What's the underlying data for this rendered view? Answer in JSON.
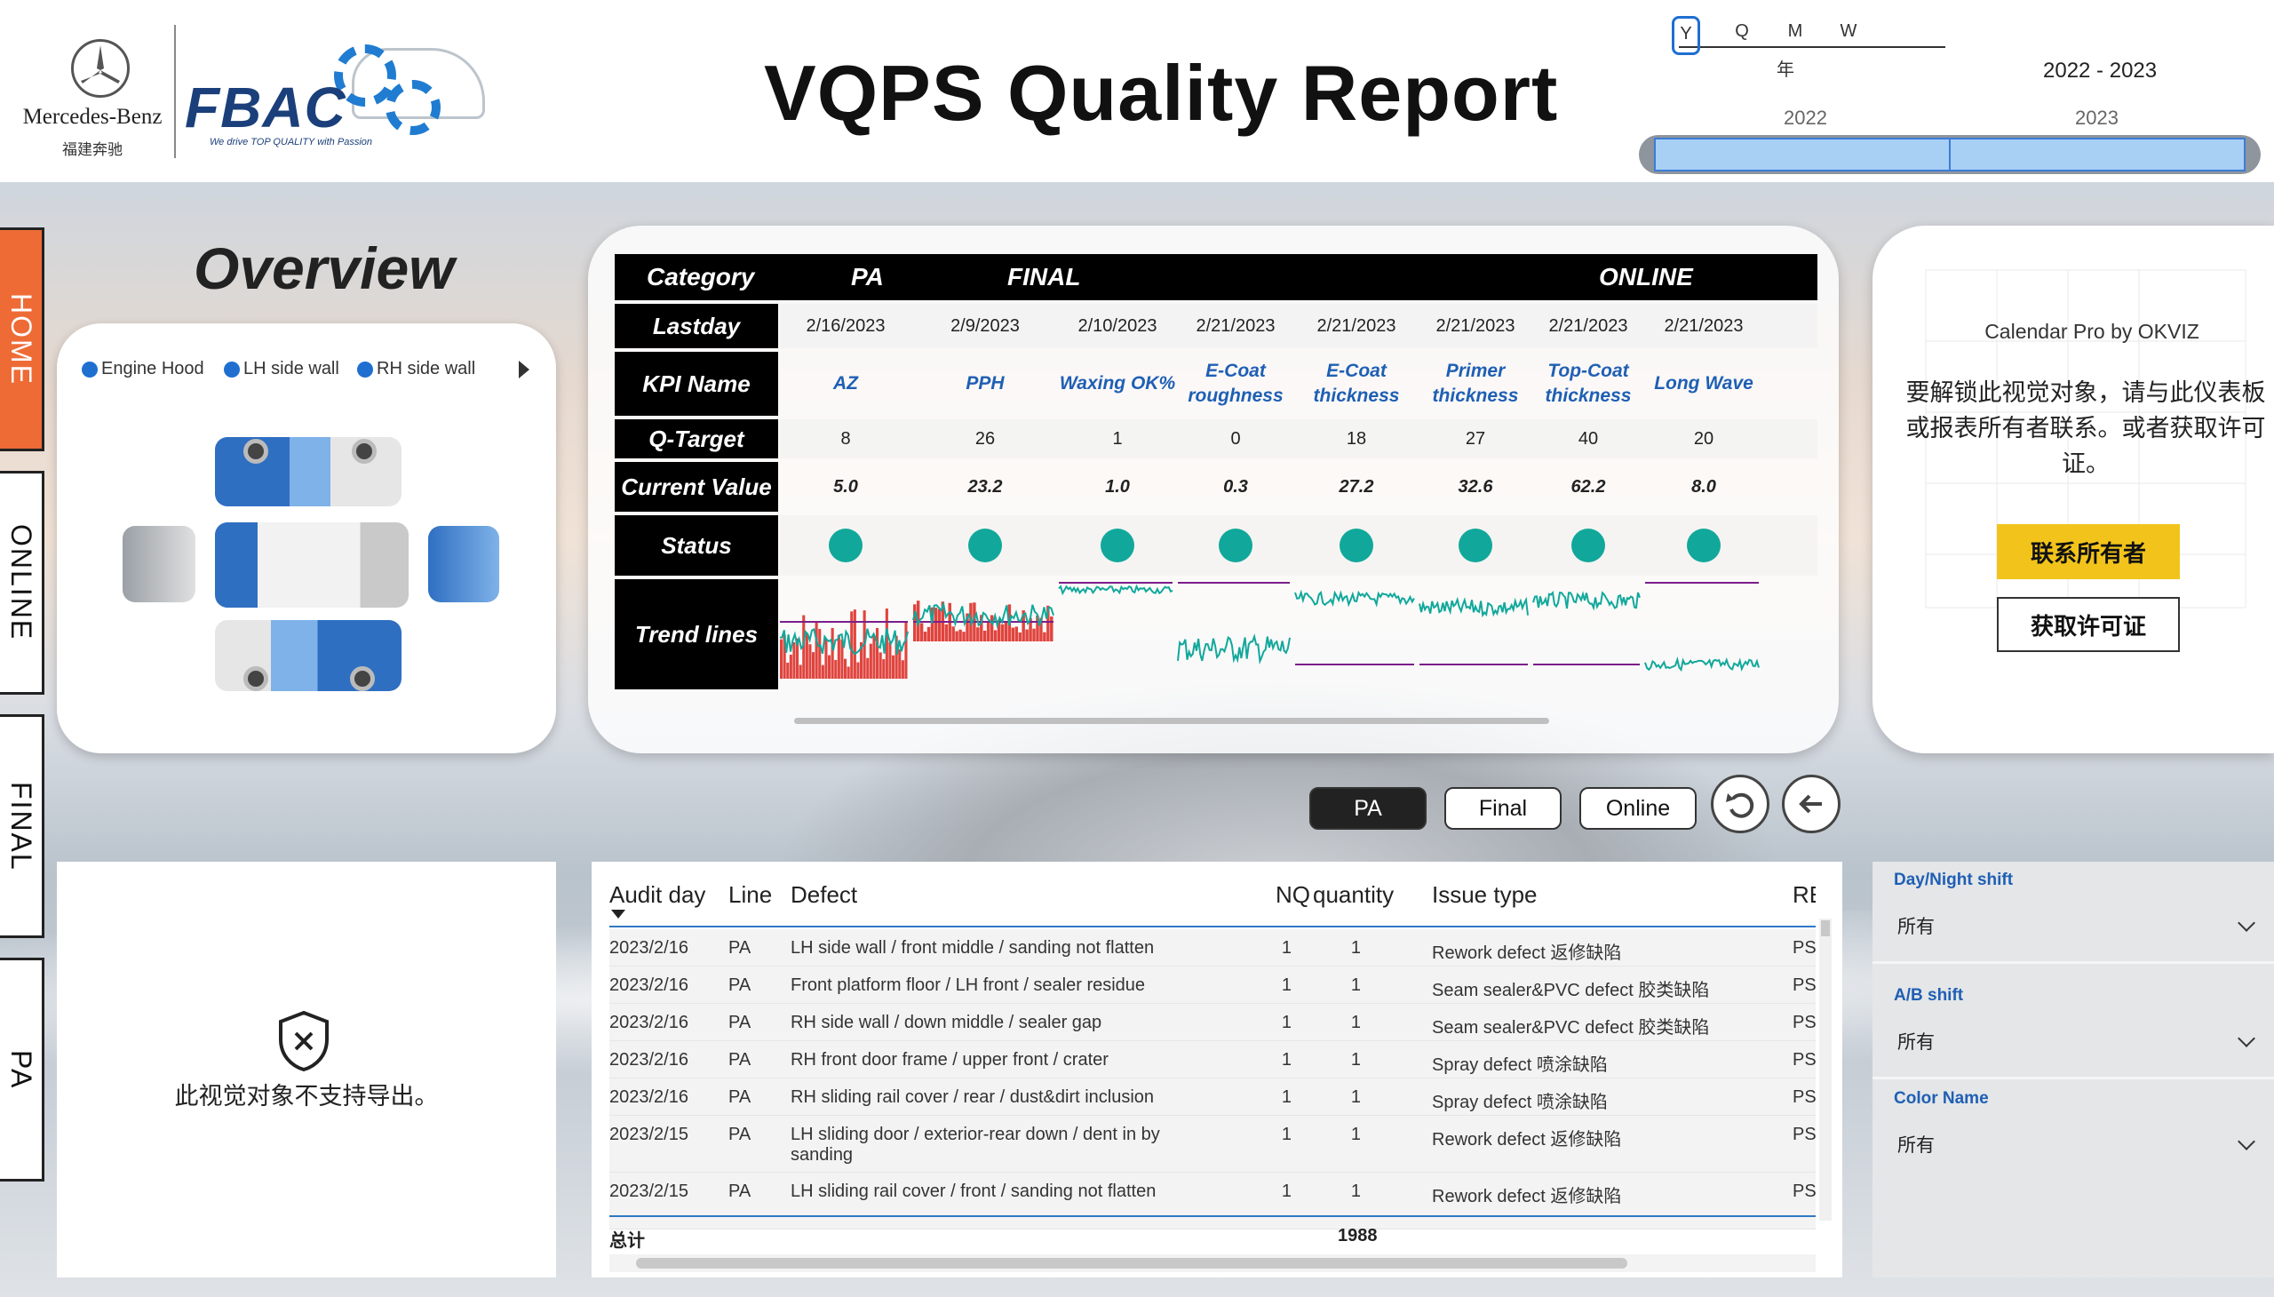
{
  "header": {
    "brand_name": "Mercedes-Benz",
    "brand_cn": "福建奔驰",
    "fbac_logo_text": "FBAC",
    "fbac_tagline": "We drive TOP QUALITY with Passion",
    "title": "VQPS Quality Report"
  },
  "period_slicer": {
    "options": [
      "Y",
      "Q",
      "M",
      "W"
    ],
    "selected": "Y",
    "level_label": "年",
    "range_label": "2022 - 2023",
    "ticks": [
      "2022",
      "2023"
    ]
  },
  "nav": {
    "tabs": [
      {
        "label": "HOME",
        "active": true
      },
      {
        "label": "ONLINE",
        "active": false
      },
      {
        "label": "FINAL",
        "active": false
      },
      {
        "label": "PA",
        "active": false
      }
    ]
  },
  "overview": {
    "title": "Overview",
    "legend": [
      "Engine Hood",
      "LH side wall",
      "RH side wall"
    ],
    "accent_color": "#1f6fd1"
  },
  "kpi_table": {
    "row_headers": {
      "category": "Category",
      "lastday": "Lastday",
      "kpi_name": "KPI Name",
      "q_target": "Q-Target",
      "current_value": "Current Value",
      "status": "Status",
      "trend_lines": "Trend lines"
    },
    "categories": [
      "PA",
      "FINAL",
      "ONLINE"
    ],
    "columns": [
      {
        "lastday": "2/16/2023",
        "kpi": "AZ",
        "target": "8",
        "current": "5.0",
        "status_color": "#11a89b"
      },
      {
        "lastday": "2/9/2023",
        "kpi": "PPH",
        "target": "26",
        "current": "23.2",
        "status_color": "#11a89b"
      },
      {
        "lastday": "2/10/2023",
        "kpi": "Waxing OK%",
        "target": "1",
        "current": "1.0",
        "status_color": "#11a89b"
      },
      {
        "lastday": "2/21/2023",
        "kpi": "E-Coat roughness",
        "target": "0",
        "current": "0.3",
        "status_color": "#11a89b"
      },
      {
        "lastday": "2/21/2023",
        "kpi": "E-Coat thickness",
        "target": "18",
        "current": "27.2",
        "status_color": "#11a89b"
      },
      {
        "lastday": "2/21/2023",
        "kpi": "Primer thickness",
        "target": "27",
        "current": "32.6",
        "status_color": "#11a89b"
      },
      {
        "lastday": "2/21/2023",
        "kpi": "Top-Coat thickness",
        "target": "40",
        "current": "62.2",
        "status_color": "#11a89b"
      },
      {
        "lastday": "2/21/2023",
        "kpi": "Long Wave",
        "target": "20",
        "current": "8.0",
        "status_color": "#11a89b"
      }
    ],
    "trend_colors": {
      "line": "#11a89b",
      "bar": "#e0443e",
      "target": "#7a1f8a"
    }
  },
  "calendar_visual": {
    "title": "Calendar Pro by OKVIZ",
    "message": "要解锁此视觉对象，请与此仪表板或报表所有者联系。或者获取许可证。",
    "contact_button": "联系所有者",
    "license_button": "获取许可证"
  },
  "view_buttons": {
    "pa": "PA",
    "final": "Final",
    "online": "Online",
    "selected": "PA"
  },
  "export_panel": {
    "message": "此视觉对象不支持导出。"
  },
  "detail_table": {
    "columns": [
      "Audit day",
      "Line",
      "Defect",
      "NQ",
      "quantity",
      "Issue type",
      "RE"
    ],
    "rows": [
      [
        "2023/2/16",
        "PA",
        "LH side wall / front middle / sanding not flatten",
        "1",
        "1",
        "Rework defect 返修缺陷",
        "PS"
      ],
      [
        "2023/2/16",
        "PA",
        "Front platform floor / LH front / sealer residue",
        "1",
        "1",
        "Seam sealer&PVC defect 胶类缺陷",
        "PS"
      ],
      [
        "2023/2/16",
        "PA",
        "RH side wall / down middle / sealer gap",
        "1",
        "1",
        "Seam sealer&PVC defect 胶类缺陷",
        "PS"
      ],
      [
        "2023/2/16",
        "PA",
        "RH front door frame / upper front / crater",
        "1",
        "1",
        "Spray defect 喷涂缺陷",
        "PS"
      ],
      [
        "2023/2/16",
        "PA",
        "RH sliding rail cover / rear / dust&dirt inclusion",
        "1",
        "1",
        "Spray defect 喷涂缺陷",
        "PS"
      ],
      [
        "2023/2/15",
        "PA",
        "LH sliding door / exterior-rear down / dent in by sanding",
        "1",
        "1",
        "Rework defect 返修缺陷",
        "PS"
      ],
      [
        "2023/2/15",
        "PA",
        "LH sliding rail cover / front / sanding not flatten",
        "1",
        "1",
        "Rework defect 返修缺陷",
        "PS"
      ]
    ],
    "total_label": "总计",
    "total_value": "1988"
  },
  "filters": [
    {
      "label": "Day/Night shift",
      "value": "所有"
    },
    {
      "label": "A/B shift",
      "value": "所有"
    },
    {
      "label": "Color Name",
      "value": "所有"
    }
  ]
}
